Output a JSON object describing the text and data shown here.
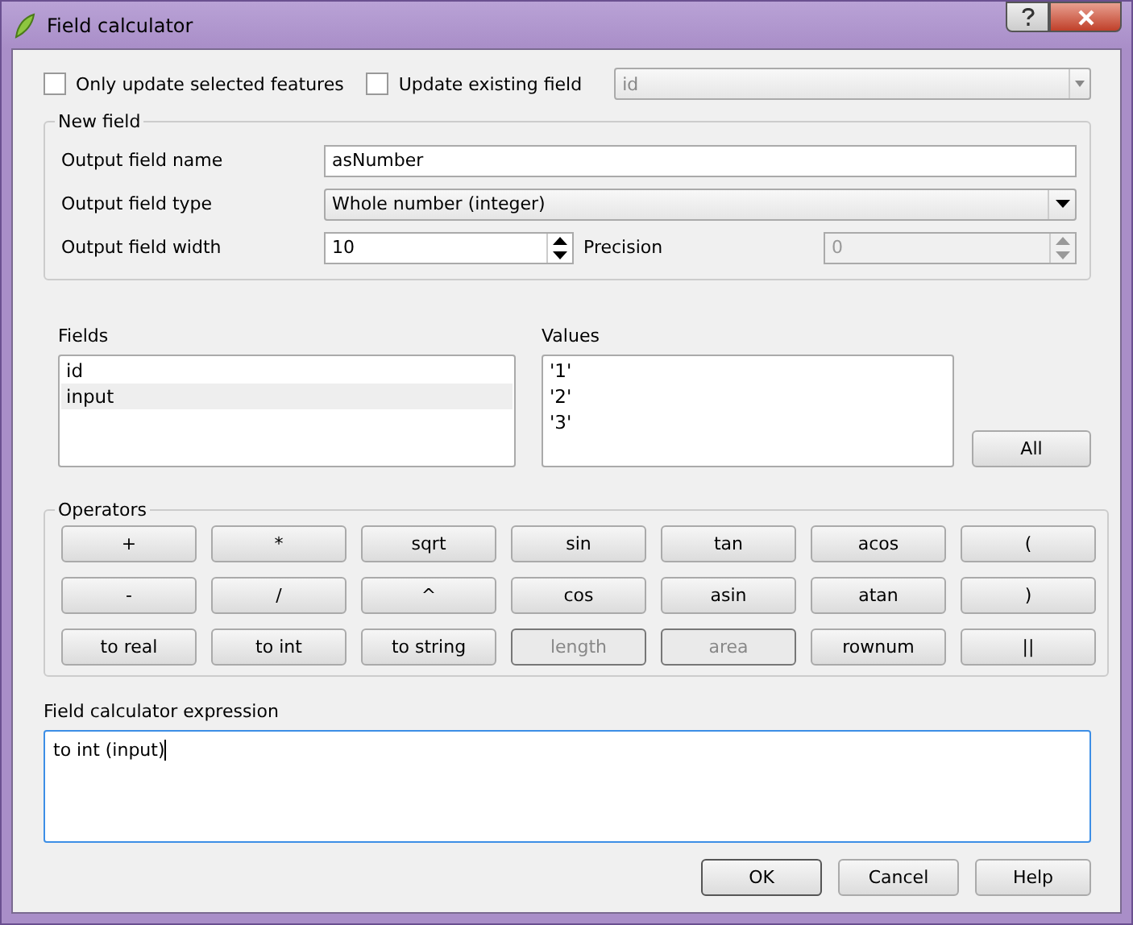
{
  "window": {
    "title": "Field calculator"
  },
  "options": [
    {
      "label": "Only update selected features",
      "checked": false
    },
    {
      "label": "Update existing field",
      "checked": false
    }
  ],
  "existing_field": {
    "value": "id",
    "disabled": true
  },
  "new_field": {
    "title": "New field",
    "name_label": "Output field name",
    "name_value": "asNumber",
    "type_label": "Output field type",
    "type_value": "Whole number (integer)",
    "width_label": "Output field width",
    "width_value": "10",
    "precision_label": "Precision",
    "precision_value": "0",
    "precision_disabled": true
  },
  "fields": {
    "title": "Fields",
    "items": [
      {
        "label": "id",
        "selected": false
      },
      {
        "label": "input",
        "selected": true
      }
    ]
  },
  "values": {
    "title": "Values",
    "items": [
      "'1'",
      "'2'",
      "'3'"
    ],
    "all_button": "All"
  },
  "operators": {
    "title": "Operators",
    "rows": [
      [
        {
          "label": "+",
          "disabled": false
        },
        {
          "label": "*",
          "disabled": false
        },
        {
          "label": "sqrt",
          "disabled": false
        },
        {
          "label": "sin",
          "disabled": false
        },
        {
          "label": "tan",
          "disabled": false
        },
        {
          "label": "acos",
          "disabled": false
        },
        {
          "label": "(",
          "disabled": false
        }
      ],
      [
        {
          "label": "-",
          "disabled": false
        },
        {
          "label": "/",
          "disabled": false
        },
        {
          "label": "^",
          "disabled": false
        },
        {
          "label": "cos",
          "disabled": false
        },
        {
          "label": "asin",
          "disabled": false
        },
        {
          "label": "atan",
          "disabled": false
        },
        {
          "label": ")",
          "disabled": false
        }
      ],
      [
        {
          "label": "to real",
          "disabled": false
        },
        {
          "label": "to int",
          "disabled": false
        },
        {
          "label": "to string",
          "disabled": false
        },
        {
          "label": "length",
          "disabled": true
        },
        {
          "label": "area",
          "disabled": true
        },
        {
          "label": "rownum",
          "disabled": false
        },
        {
          "label": "||",
          "disabled": false
        }
      ]
    ]
  },
  "expression": {
    "label": "Field calculator expression",
    "value": "to int (input)"
  },
  "buttons": [
    "OK",
    "Cancel",
    "Help"
  ]
}
